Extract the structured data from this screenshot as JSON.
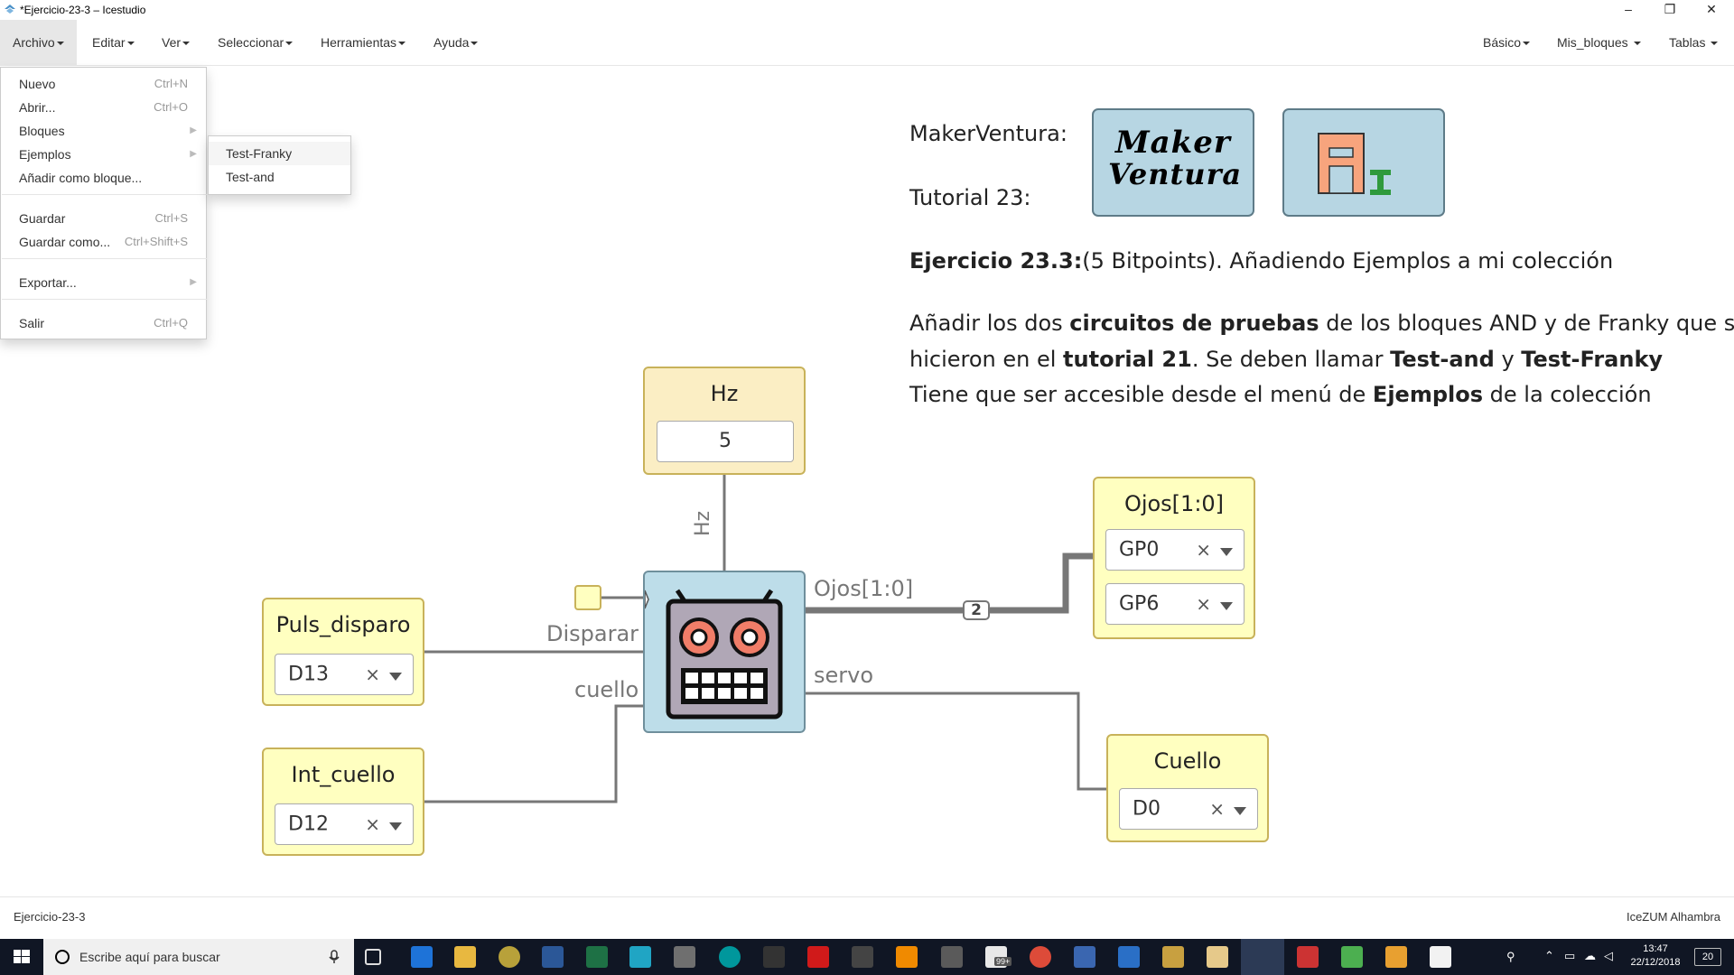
{
  "window": {
    "title": "*Ejercicio-23-3 – Icestudio",
    "controls": {
      "minimize": "–",
      "maximize": "❐",
      "close": "✕"
    }
  },
  "menubar": {
    "left": [
      "Archivo",
      "Editar",
      "Ver",
      "Seleccionar",
      "Herramientas",
      "Ayuda"
    ],
    "right": [
      "Básico",
      "Mis_bloques",
      "Tablas"
    ]
  },
  "file_menu": {
    "items": [
      {
        "label": "Nuevo",
        "shortcut": "Ctrl+N"
      },
      {
        "label": "Abrir...",
        "shortcut": "Ctrl+O"
      },
      {
        "label": "Bloques",
        "shortcut": ""
      },
      {
        "label": "Ejemplos",
        "shortcut": ""
      },
      {
        "label": "Añadir como bloque...",
        "shortcut": ""
      },
      {
        "label": "Guardar",
        "shortcut": "Ctrl+S"
      },
      {
        "label": "Guardar como...",
        "shortcut": "Ctrl+Shift+S"
      },
      {
        "label": "Exportar...",
        "shortcut": ""
      },
      {
        "label": "Salir",
        "shortcut": "Ctrl+Q"
      }
    ]
  },
  "examples_submenu": [
    "Test-Franky",
    "Test-and"
  ],
  "info": {
    "makerventura_label": "MakerVentura:",
    "tutorial_label": "Tutorial 23:",
    "exercise_bold": "Ejercicio 23.3:",
    "exercise_rest": "(5 Bitpoints). Añadiendo Ejemplos a mi colección",
    "p1": {
      "a": "Añadir los dos ",
      "b": "circuitos de pruebas",
      "c": " de los bloques AND y de Franky que se"
    },
    "p2": {
      "a": "hicieron en el ",
      "b": "tutorial 21",
      "c": ". Se deben llamar ",
      "d": "Test-and",
      "e": " y ",
      "f": "Test-Franky"
    },
    "p3": {
      "a": "Tiene que ser accesible desde el menú de ",
      "b": "Ejemplos",
      "c": " de la colección"
    },
    "logo1_top": "Maker",
    "logo1_bottom": "Ventura"
  },
  "blocks": {
    "hz": {
      "name": "Hz",
      "value": "5"
    },
    "puls": {
      "name": "Puls_disparo",
      "pin": "D13"
    },
    "intc": {
      "name": "Int_cuello",
      "pin": "D12"
    },
    "ojos": {
      "name": "Ojos[1:0]",
      "pins": [
        "GP0",
        "GP6"
      ]
    },
    "cuello": {
      "name": "Cuello",
      "pin": "D0"
    }
  },
  "ports": {
    "hz": "Hz",
    "disparar": "Disparar",
    "cuello": "cuello",
    "ojos": "Ojos[1:0]",
    "servo": "servo",
    "bus_width": "2"
  },
  "statusbar": {
    "left": "Ejercicio-23-3",
    "right": "IceZUM Alhambra"
  },
  "taskbar": {
    "search_placeholder": "Escribe aquí para buscar",
    "time": "13:47",
    "date": "22/12/2018",
    "notifications": "20",
    "badge": "99+"
  },
  "colors": {
    "io_block": "#ffffc0",
    "const_block": "#fbeec4",
    "module_block": "#bddde9",
    "wire": "#777777",
    "taskbar": "#101624"
  }
}
